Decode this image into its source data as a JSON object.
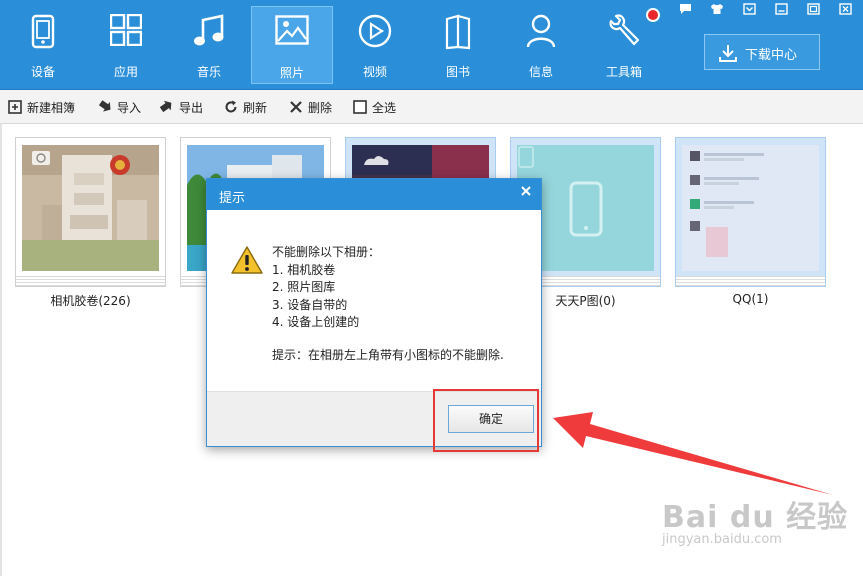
{
  "nav": {
    "items": [
      {
        "label": "设备",
        "icon": "device-icon"
      },
      {
        "label": "应用",
        "icon": "apps-icon"
      },
      {
        "label": "音乐",
        "icon": "music-icon"
      },
      {
        "label": "照片",
        "icon": "photo-icon",
        "active": true
      },
      {
        "label": "视频",
        "icon": "video-icon"
      },
      {
        "label": "图书",
        "icon": "book-icon"
      },
      {
        "label": "信息",
        "icon": "message-icon"
      },
      {
        "label": "工具箱",
        "icon": "toolbox-icon"
      }
    ],
    "download_label": "下载中心"
  },
  "toolbar": {
    "new_album": "新建相簿",
    "import": "导入",
    "export": "导出",
    "refresh": "刷新",
    "delete": "删除",
    "select_all": "全选"
  },
  "albums": [
    {
      "label": "相机胶卷(226)"
    },
    {
      "label": ""
    },
    {
      "label": ""
    },
    {
      "label": "天天P图(0)"
    },
    {
      "label": "QQ(1)"
    }
  ],
  "dialog": {
    "title": "提示",
    "lines": [
      "不能删除以下相册：",
      "1. 相机胶卷",
      "2. 照片图库",
      "3. 设备自带的",
      "4. 设备上创建的"
    ],
    "tip": "提示：在相册左上角带有小图标的不能删除.",
    "ok_label": "确定"
  },
  "watermark": {
    "text": "Bai du 经验",
    "url": "jingyan.baidu.com"
  },
  "colors": {
    "accent": "#2a8fd8",
    "annotation": "#e53935"
  }
}
